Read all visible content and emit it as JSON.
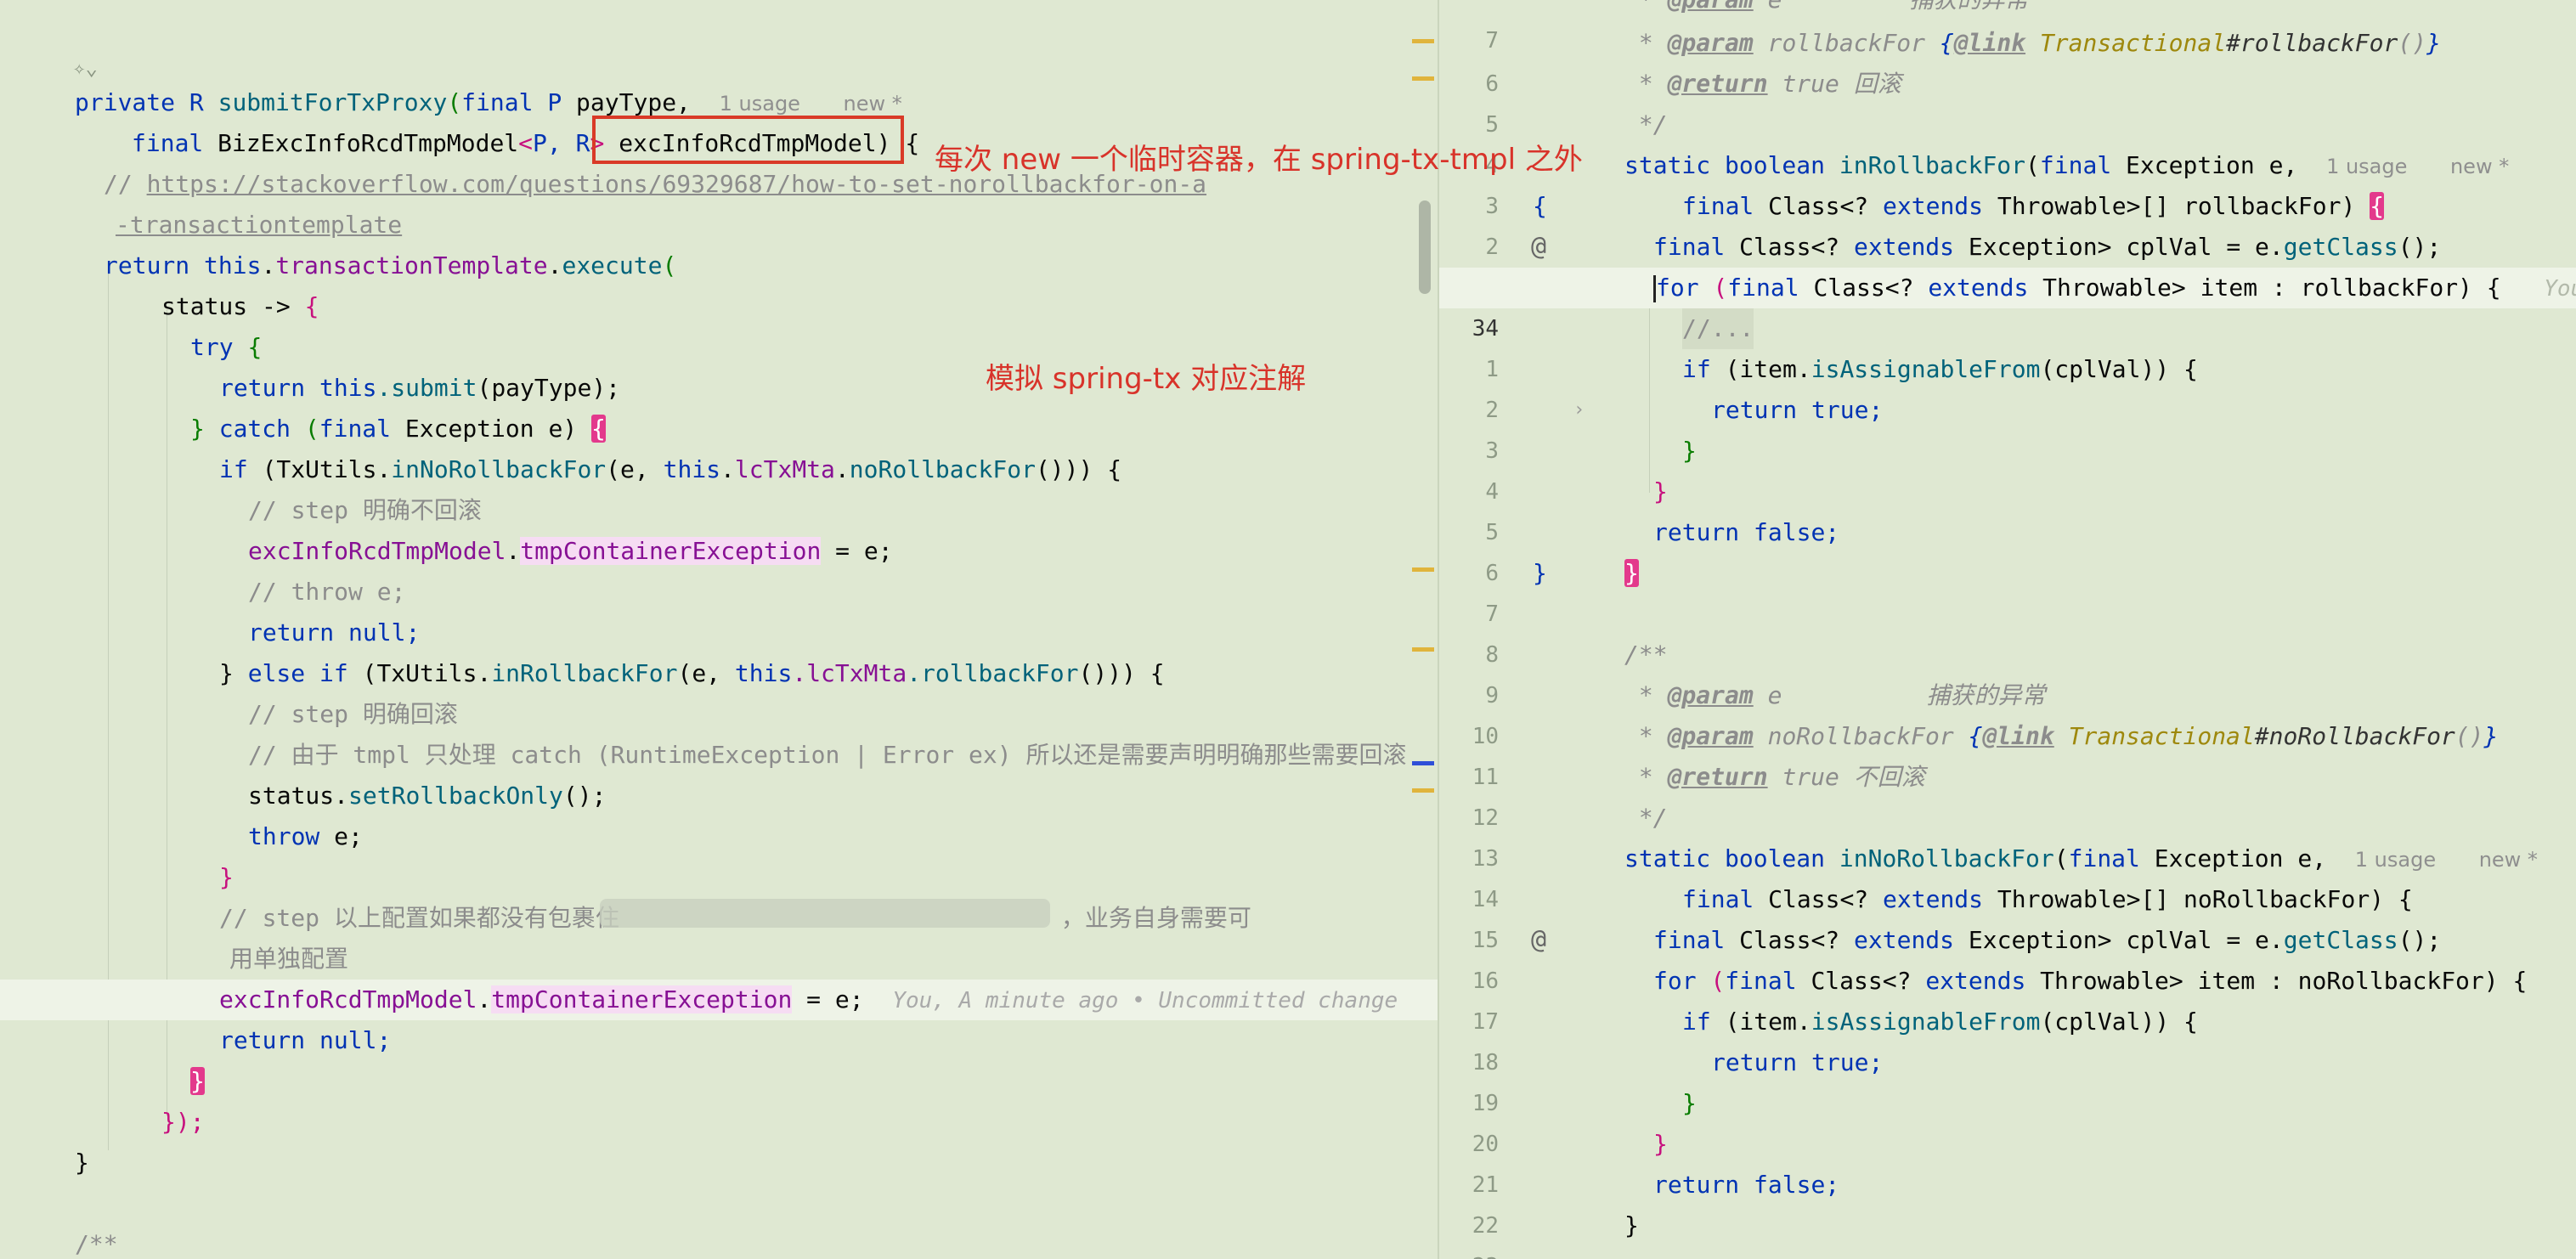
{
  "left": {
    "lines": {
      "method_sig": {
        "mod": "private",
        "rtype": "R",
        "name": "submitForTxProxy",
        "open": "(",
        "final": "final",
        "ptype": "P",
        "param": "payType,",
        "usage": "1 usage",
        "new": "new *"
      },
      "param2": {
        "final": "final",
        "type": "BizExcInfoRcdTmpModel",
        "lt": "<",
        "p": "P,",
        "r": "R",
        "gt": ">",
        "name": "excInfoRcdTmpModel)",
        "brace": "{"
      },
      "comment_url": {
        "prefix": "// ",
        "url1": "https://stackoverflow.com/questions/69329687/how-to-set-norollbackfor-on-a",
        "url2": "-transactiontemplate"
      },
      "return_exec": {
        "kw": "return",
        "this": "this",
        "dot1": ".",
        "field": "transactionTemplate",
        "dot2": ".",
        "fn": "execute",
        "paren": "("
      },
      "lambda": {
        "var": "status",
        "arrow": " -> ",
        "brace": "{"
      },
      "try": {
        "kw": "try",
        "brace": "{"
      },
      "ret_submit": {
        "kw": "return",
        "this": "this",
        "fn": ".submit",
        "arg": "(payType);"
      },
      "catch": {
        "close": "}",
        "kw": "catch",
        "open": "(",
        "final": "final",
        "type": "Exception",
        "var": "e)",
        "brace": "{"
      },
      "if1": {
        "kw": "if",
        "cond1": "(TxUtils.",
        "fn": "inNoRollbackFor",
        "cond2": "(e, ",
        "this": "this",
        ".": ".",
        "fld": "lcTxMta",
        ".2": ".",
        "fn2": "noRollbackFor",
        "end": "())) {"
      },
      "c_step1": "// step 明确不回滚",
      "assign1": {
        "obj": "excInfoRcdTmpModel",
        "dot": ".",
        "fld": "tmpContainerException",
        "rest": " = e;"
      },
      "c_throw": "// throw e;",
      "ret_null1": {
        "kw": "return",
        "val": "null;"
      },
      "elseif": {
        "close": "}",
        "kw": "else if",
        "cond1": "(TxUtils.",
        "fn": "inRollbackFor",
        "cond2": "(e, ",
        "this": "this",
        "fld": ".lcTxMta",
        "fn2": ".rollbackFor",
        "end": "())) {"
      },
      "c_step2": "// step 明确回滚",
      "c_tmpl": "// 由于 tmpl 只处理 catch (RuntimeException | Error ex) 所以还是需要声明明确那些需要回滚",
      "set_rb": {
        "obj": "status.",
        "fn": "setRollbackOnly",
        "end": "();"
      },
      "throw": {
        "kw": "throw",
        "var": "e;"
      },
      "close_if": "}",
      "c_step3a": "// step 以上配置如果都没有包裹住",
      "c_step3b": "，业务自身需要可",
      "c_step3c": "用单独配置",
      "assign2": {
        "obj": "excInfoRcdTmpModel",
        "dot": ".",
        "fld": "tmpContainerException",
        "rest": " = e;",
        "blame": "You, A minute ago • Uncommitted change"
      },
      "ret_null2": {
        "kw": "return",
        "val": "null;"
      },
      "close_lambda": "}",
      "close_exec": "});",
      "close_method": "}",
      "javadoc_start": "/**"
    },
    "annotations": {
      "box_text": "每次 new 一个临时容器，在 spring-tx-tmpl 之外",
      "simulate_text": "模拟 spring-tx 对应注解"
    }
  },
  "right": {
    "lines": [
      {
        "num": "7",
        "doc": " * ",
        "tag": "@param",
        "rest": " e",
        "desc": "捕获的异常"
      },
      {
        "num": "6",
        "doc": " * ",
        "tag": "@param",
        "rest": " rollbackFor ",
        "link_open": "{",
        "link": "@link",
        "ann": " Transactional",
        "hash": "#rollbackFor",
        "paren": "()",
        "close": "}"
      },
      {
        "num": "5",
        "doc": " * ",
        "tag": "@return",
        "rest": " true 回滚"
      },
      {
        "num": "4",
        "doc": " */"
      },
      {
        "num": "3",
        "mods": "static boolean ",
        "fn": "inRollbackFor",
        "open": "(",
        "final": "final",
        "type": " Exception e,",
        "usage": "1 usage",
        "new": "new *"
      },
      {
        "num": "2",
        "brace": "{",
        "final": "final",
        "type": " Class<? ",
        "ext": "extends",
        "thr": " Throwable>[] rollbackFor)",
        "b": "{"
      },
      {
        "num": "1",
        "final": "final",
        "type": " Class<? ",
        "ext": "extends",
        "exc": " Exception> cplVal = e.",
        "fn": "getClass",
        "end": "();"
      },
      {
        "num": "34",
        "for": "for",
        "open": " (",
        "final": "final",
        "type": " Class<? ",
        "ext": "extends",
        "thr": " Throwable> item : rollbackFor) {",
        "ghost": "You"
      },
      {
        "num": "1",
        "text": "//..."
      },
      {
        "num": "2",
        "kw": "if",
        "cond": " (item.",
        "fn": "isAssignableFrom",
        "end": "(cplVal)) {"
      },
      {
        "num": "3",
        "kw": "return",
        "val": " true;"
      },
      {
        "num": "4",
        "text": "}"
      },
      {
        "num": "5",
        "text": "}"
      },
      {
        "num": "6",
        "kw": "return",
        "val": " false;"
      },
      {
        "num": "7",
        "brace": "}",
        "b": "}"
      },
      {
        "num": "8"
      },
      {
        "num": "9",
        "doc": "/**"
      },
      {
        "num": "10",
        "doc": " * ",
        "tag": "@param",
        "rest": " e",
        "desc": "捕获的异常"
      },
      {
        "num": "11",
        "doc": " * ",
        "tag": "@param",
        "rest": " noRollbackFor ",
        "link_open": "{",
        "link": "@link",
        "ann": " Transactional",
        "hash": "#noRollbackFor",
        "paren": "()",
        "close": "}"
      },
      {
        "num": "12",
        "doc": " * ",
        "tag": "@return",
        "rest": " true 不回滚"
      },
      {
        "num": "13",
        "doc": " */"
      },
      {
        "num": "14",
        "mods": "static boolean ",
        "fn": "inNoRollbackFor",
        "open": "(",
        "final": "final",
        "type": " Exception e,",
        "usage": "1 usage",
        "new": "new *"
      },
      {
        "num": "15",
        "final": "final",
        "type": " Class<? ",
        "ext": "extends",
        "thr": " Throwable>[] noRollbackFor) {"
      },
      {
        "num": "16",
        "final": "final",
        "type": " Class<? ",
        "ext": "extends",
        "exc": " Exception> cplVal = e.",
        "fn": "getClass",
        "end": "();"
      },
      {
        "num": "17",
        "for": "for",
        "open": " (",
        "final": "final",
        "type": " Class<? ",
        "ext": "extends",
        "thr": " Throwable> item : noRollbackFor) {"
      },
      {
        "num": "18",
        "kw": "if",
        "cond": " (item.",
        "fn": "isAssignableFrom",
        "end": "(cplVal)) {"
      },
      {
        "num": "19",
        "kw": "return",
        "val": " true;"
      },
      {
        "num": "20",
        "text": "}"
      },
      {
        "num": "21",
        "text": "}"
      },
      {
        "num": "22",
        "kw": "return",
        "val": " false;"
      },
      {
        "num": "23",
        "text": "}"
      }
    ]
  },
  "colors": {
    "background": "#dfe8d2",
    "keyword": "#0033b3",
    "comment": "#8c8c8c",
    "field": "#871094",
    "function": "#00627a",
    "annotation_red": "#d8332a",
    "brace_highlight": "#e3398c"
  },
  "icons": [
    "ai-assist-icon",
    "at-sign-icon",
    "fold-chevron-icon"
  ]
}
